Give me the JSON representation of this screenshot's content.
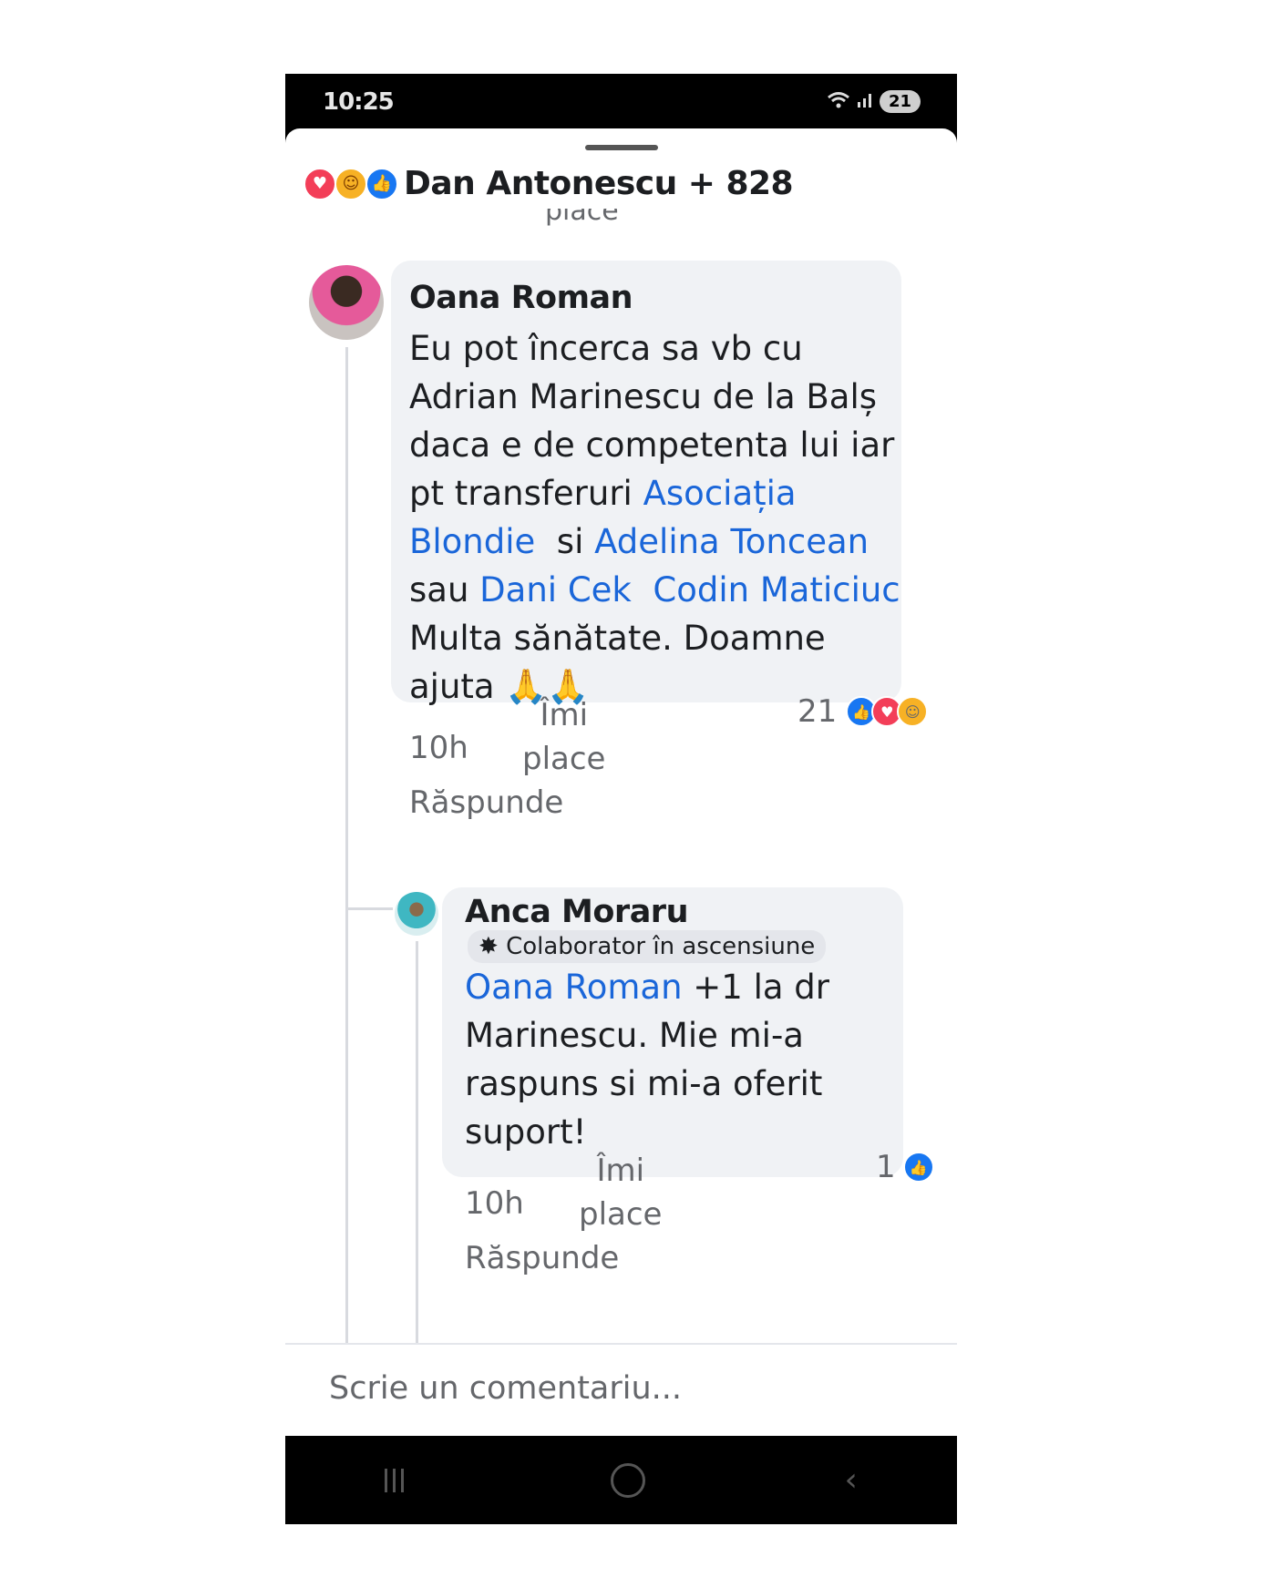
{
  "status_bar": {
    "time": "10:25",
    "battery": "21"
  },
  "header": {
    "reactions": [
      "love",
      "haha",
      "like"
    ],
    "title": "Dan Antonescu + 828"
  },
  "previous_fragment": "place",
  "comments": [
    {
      "author": "Oana Roman",
      "lines": [
        [
          {
            "text": "Eu pot încerca sa vb cu"
          }
        ],
        [
          {
            "text": "Adrian Marinescu de la Balș"
          }
        ],
        [
          {
            "text": "daca e de competenta lui iar"
          }
        ],
        [
          {
            "text": "pt transferuri "
          },
          {
            "text": "Asociația",
            "mention": true
          }
        ],
        [
          {
            "text": "Blondie",
            "mention": true
          },
          {
            "text": "  si "
          },
          {
            "text": "Adelina Toncean",
            "mention": true
          }
        ],
        [
          {
            "text": "sau "
          },
          {
            "text": "Dani Cek",
            "mention": true
          },
          {
            "text": "  "
          },
          {
            "text": "Codin Maticiuc",
            "mention": true
          }
        ],
        [
          {
            "text": "Multa sănătate. Doamne"
          }
        ],
        [
          {
            "text": "ajuta 🙏🙏"
          }
        ]
      ],
      "time": "10h",
      "like_label_1": "Îmi",
      "like_label_2": "place",
      "reply_label": "Răspunde",
      "reaction_count": "21"
    },
    {
      "author": "Anca Moraru",
      "badge": "Colaborator în ascensiune",
      "lines": [
        [
          {
            "text": "Oana Roman",
            "mention": true
          },
          {
            "text": " +1 la dr"
          }
        ],
        [
          {
            "text": "Marinescu. Mie mi-a"
          }
        ],
        [
          {
            "text": "raspuns si mi-a oferit"
          }
        ],
        [
          {
            "text": "suport!"
          }
        ]
      ],
      "time": "10h",
      "like_label_1": "Îmi",
      "like_label_2": "place",
      "reply_label": "Răspunde",
      "reaction_count": "1"
    }
  ],
  "composer": {
    "placeholder": "Scrie un comentariu..."
  },
  "colors": {
    "mention": "#1a66d9",
    "bubble": "#f0f2f5",
    "like": "#1877f2",
    "love": "#f33e58"
  }
}
